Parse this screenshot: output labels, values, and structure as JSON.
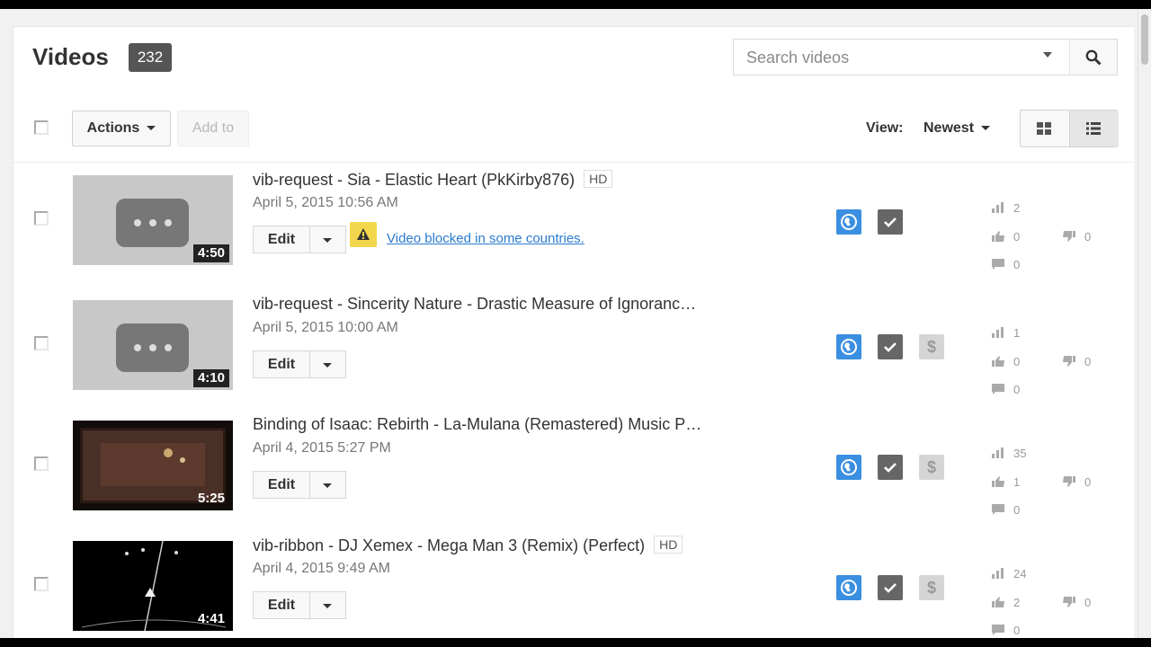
{
  "header": {
    "title": "Videos",
    "count": "232"
  },
  "search": {
    "placeholder": "Search videos"
  },
  "toolbar": {
    "actions_label": "Actions",
    "add_to_label": "Add to",
    "view_label": "View:",
    "sort_label": "Newest"
  },
  "videos": [
    {
      "title": "vib-request - Sia - Elastic Heart (PkKirby876)",
      "hd": "HD",
      "date": "April 5, 2015 10:56 AM",
      "duration": "4:50",
      "edit": "Edit",
      "warning": "Video blocked in some countries.",
      "views": "2",
      "likes": "0",
      "dislikes": "0",
      "comments": "0",
      "monetized": false
    },
    {
      "title": "vib-request - Sincerity Nature - Drastic Measure of Ignoranc…",
      "hd": "",
      "date": "April 5, 2015 10:00 AM",
      "duration": "4:10",
      "edit": "Edit",
      "views": "1",
      "likes": "0",
      "dislikes": "0",
      "comments": "0",
      "monetized": true
    },
    {
      "title": "Binding of Isaac: Rebirth - La-Mulana (Remastered) Music P…",
      "hd": "",
      "date": "April 4, 2015 5:27 PM",
      "duration": "5:25",
      "edit": "Edit",
      "views": "35",
      "likes": "1",
      "dislikes": "0",
      "comments": "0",
      "monetized": true
    },
    {
      "title": "vib-ribbon - DJ Xemex - Mega Man 3 (Remix) (Perfect)",
      "hd": "HD",
      "date": "April 4, 2015 9:49 AM",
      "duration": "4:41",
      "edit": "Edit",
      "views": "24",
      "likes": "2",
      "dislikes": "0",
      "comments": "0",
      "monetized": true
    }
  ],
  "icons": {
    "globe": "globe-icon",
    "check": "check-icon",
    "dollar": "$",
    "views": "bar-chart-icon",
    "like": "thumbs-up-icon",
    "dislike": "thumbs-down-icon",
    "comment": "comment-icon"
  },
  "colors": {
    "public_blue": "#3b8fe0",
    "warning_yellow": "#f2d64b",
    "link_blue": "#2a7bd0"
  }
}
